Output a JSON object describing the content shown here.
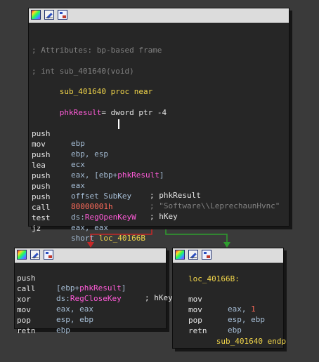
{
  "main_block": {
    "attributes_comment": "; Attributes: bp-based frame",
    "signature_comment": "; int sub_401640(void)",
    "proc_name": "sub_401640",
    "proc_keyword": "proc near",
    "local_var": "phkResult",
    "local_decl": "= dword ptr -4",
    "instructions": [
      {
        "mn": "push",
        "ops": [
          "ebp"
        ],
        "comment": ""
      },
      {
        "mn": "mov",
        "ops": [
          "ebp, esp"
        ],
        "comment": ""
      },
      {
        "mn": "push",
        "ops": [
          "ecx"
        ],
        "comment": ""
      },
      {
        "mn": "lea",
        "ops": [
          "eax, [ebp+",
          "phkResult",
          "]"
        ],
        "comment": ""
      },
      {
        "mn": "push",
        "ops": [
          "eax"
        ],
        "comment": "; phkResult"
      },
      {
        "mn": "push",
        "ops": [
          "offset SubKey"
        ],
        "comment": "; \"Software\\\\LeprechaunHvnc\""
      },
      {
        "mn": "push",
        "ops": [
          "80000001h"
        ],
        "comment": "; hKey"
      },
      {
        "mn": "call",
        "ops": [
          "ds:",
          "RegOpenKeyW"
        ],
        "comment": ""
      },
      {
        "mn": "test",
        "ops": [
          "eax, eax"
        ],
        "comment": ""
      },
      {
        "mn": "jz",
        "ops": [
          "short ",
          "loc_40166B"
        ],
        "comment": ""
      }
    ]
  },
  "left_block": {
    "instructions": [
      {
        "mn": "push",
        "ops": [
          "[ebp+",
          "phkResult",
          "]"
        ],
        "comment": "; hKey"
      },
      {
        "mn": "call",
        "ops": [
          "ds:",
          "RegCloseKey"
        ],
        "comment": ""
      },
      {
        "mn": "xor",
        "ops": [
          "eax, eax"
        ],
        "comment": ""
      },
      {
        "mn": "mov",
        "ops": [
          "esp, ebp"
        ],
        "comment": ""
      },
      {
        "mn": "pop",
        "ops": [
          "ebp"
        ],
        "comment": ""
      },
      {
        "mn": "retn",
        "ops": [
          ""
        ],
        "comment": ""
      }
    ]
  },
  "right_block": {
    "label": "loc_40166B:",
    "instructions": [
      {
        "mn": "mov",
        "ops": [
          "eax, ",
          "1"
        ],
        "comment": ""
      },
      {
        "mn": "mov",
        "ops": [
          "esp, ebp"
        ],
        "comment": ""
      },
      {
        "mn": "pop",
        "ops": [
          "ebp"
        ],
        "comment": ""
      },
      {
        "mn": "retn",
        "ops": [
          ""
        ],
        "comment": ""
      }
    ],
    "endp_name": "sub_401640",
    "endp_keyword": "endp"
  },
  "edges": [
    {
      "name": "false-branch",
      "color": "#c62828"
    },
    {
      "name": "true-branch",
      "color": "#2e9e2e"
    }
  ],
  "icons": [
    "palette-icon",
    "edit-icon",
    "graph-icon"
  ]
}
